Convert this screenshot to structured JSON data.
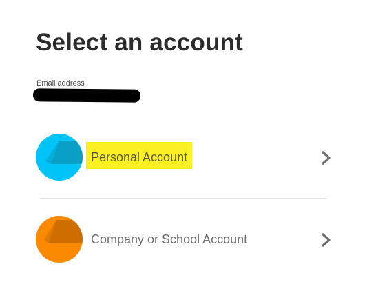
{
  "page": {
    "title": "Select an account",
    "email_label": "Email address"
  },
  "accounts": [
    {
      "label": "Personal Account",
      "avatar_color": "#00c3f7",
      "avatar_shade": "#0a9fc6",
      "highlighted": true,
      "highlight_color": "#fbf023"
    },
    {
      "label": "Company or School Account",
      "avatar_color": "#fb8a00",
      "avatar_shade": "#cf6e00",
      "highlighted": false
    }
  ],
  "icons": {
    "chevron": "chevron-right-icon"
  }
}
